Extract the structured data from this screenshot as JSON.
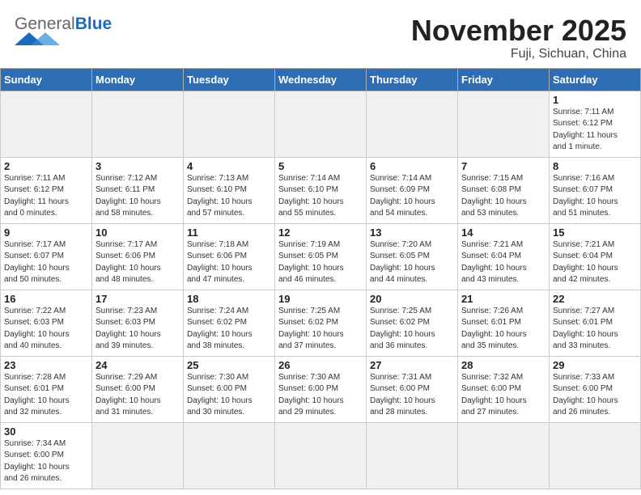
{
  "header": {
    "logo_general": "General",
    "logo_blue": "Blue",
    "month_title": "November 2025",
    "location": "Fuji, Sichuan, China"
  },
  "weekdays": [
    "Sunday",
    "Monday",
    "Tuesday",
    "Wednesday",
    "Thursday",
    "Friday",
    "Saturday"
  ],
  "weeks": [
    [
      {
        "day": "",
        "info": ""
      },
      {
        "day": "",
        "info": ""
      },
      {
        "day": "",
        "info": ""
      },
      {
        "day": "",
        "info": ""
      },
      {
        "day": "",
        "info": ""
      },
      {
        "day": "",
        "info": ""
      },
      {
        "day": "1",
        "info": "Sunrise: 7:11 AM\nSunset: 6:12 PM\nDaylight: 11 hours\nand 1 minute."
      }
    ],
    [
      {
        "day": "2",
        "info": "Sunrise: 7:11 AM\nSunset: 6:12 PM\nDaylight: 11 hours\nand 0 minutes."
      },
      {
        "day": "3",
        "info": "Sunrise: 7:12 AM\nSunset: 6:11 PM\nDaylight: 10 hours\nand 58 minutes."
      },
      {
        "day": "4",
        "info": "Sunrise: 7:13 AM\nSunset: 6:10 PM\nDaylight: 10 hours\nand 57 minutes."
      },
      {
        "day": "5",
        "info": "Sunrise: 7:14 AM\nSunset: 6:10 PM\nDaylight: 10 hours\nand 55 minutes."
      },
      {
        "day": "6",
        "info": "Sunrise: 7:14 AM\nSunset: 6:09 PM\nDaylight: 10 hours\nand 54 minutes."
      },
      {
        "day": "7",
        "info": "Sunrise: 7:15 AM\nSunset: 6:08 PM\nDaylight: 10 hours\nand 53 minutes."
      },
      {
        "day": "8",
        "info": "Sunrise: 7:16 AM\nSunset: 6:07 PM\nDaylight: 10 hours\nand 51 minutes."
      }
    ],
    [
      {
        "day": "9",
        "info": "Sunrise: 7:17 AM\nSunset: 6:07 PM\nDaylight: 10 hours\nand 50 minutes."
      },
      {
        "day": "10",
        "info": "Sunrise: 7:17 AM\nSunset: 6:06 PM\nDaylight: 10 hours\nand 48 minutes."
      },
      {
        "day": "11",
        "info": "Sunrise: 7:18 AM\nSunset: 6:06 PM\nDaylight: 10 hours\nand 47 minutes."
      },
      {
        "day": "12",
        "info": "Sunrise: 7:19 AM\nSunset: 6:05 PM\nDaylight: 10 hours\nand 46 minutes."
      },
      {
        "day": "13",
        "info": "Sunrise: 7:20 AM\nSunset: 6:05 PM\nDaylight: 10 hours\nand 44 minutes."
      },
      {
        "day": "14",
        "info": "Sunrise: 7:21 AM\nSunset: 6:04 PM\nDaylight: 10 hours\nand 43 minutes."
      },
      {
        "day": "15",
        "info": "Sunrise: 7:21 AM\nSunset: 6:04 PM\nDaylight: 10 hours\nand 42 minutes."
      }
    ],
    [
      {
        "day": "16",
        "info": "Sunrise: 7:22 AM\nSunset: 6:03 PM\nDaylight: 10 hours\nand 40 minutes."
      },
      {
        "day": "17",
        "info": "Sunrise: 7:23 AM\nSunset: 6:03 PM\nDaylight: 10 hours\nand 39 minutes."
      },
      {
        "day": "18",
        "info": "Sunrise: 7:24 AM\nSunset: 6:02 PM\nDaylight: 10 hours\nand 38 minutes."
      },
      {
        "day": "19",
        "info": "Sunrise: 7:25 AM\nSunset: 6:02 PM\nDaylight: 10 hours\nand 37 minutes."
      },
      {
        "day": "20",
        "info": "Sunrise: 7:25 AM\nSunset: 6:02 PM\nDaylight: 10 hours\nand 36 minutes."
      },
      {
        "day": "21",
        "info": "Sunrise: 7:26 AM\nSunset: 6:01 PM\nDaylight: 10 hours\nand 35 minutes."
      },
      {
        "day": "22",
        "info": "Sunrise: 7:27 AM\nSunset: 6:01 PM\nDaylight: 10 hours\nand 33 minutes."
      }
    ],
    [
      {
        "day": "23",
        "info": "Sunrise: 7:28 AM\nSunset: 6:01 PM\nDaylight: 10 hours\nand 32 minutes."
      },
      {
        "day": "24",
        "info": "Sunrise: 7:29 AM\nSunset: 6:00 PM\nDaylight: 10 hours\nand 31 minutes."
      },
      {
        "day": "25",
        "info": "Sunrise: 7:30 AM\nSunset: 6:00 PM\nDaylight: 10 hours\nand 30 minutes."
      },
      {
        "day": "26",
        "info": "Sunrise: 7:30 AM\nSunset: 6:00 PM\nDaylight: 10 hours\nand 29 minutes."
      },
      {
        "day": "27",
        "info": "Sunrise: 7:31 AM\nSunset: 6:00 PM\nDaylight: 10 hours\nand 28 minutes."
      },
      {
        "day": "28",
        "info": "Sunrise: 7:32 AM\nSunset: 6:00 PM\nDaylight: 10 hours\nand 27 minutes."
      },
      {
        "day": "29",
        "info": "Sunrise: 7:33 AM\nSunset: 6:00 PM\nDaylight: 10 hours\nand 26 minutes."
      }
    ],
    [
      {
        "day": "30",
        "info": "Sunrise: 7:34 AM\nSunset: 6:00 PM\nDaylight: 10 hours\nand 26 minutes."
      },
      {
        "day": "",
        "info": ""
      },
      {
        "day": "",
        "info": ""
      },
      {
        "day": "",
        "info": ""
      },
      {
        "day": "",
        "info": ""
      },
      {
        "day": "",
        "info": ""
      },
      {
        "day": "",
        "info": ""
      }
    ]
  ]
}
